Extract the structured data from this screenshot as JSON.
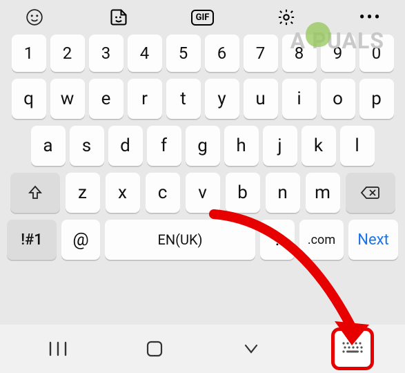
{
  "toolbar": {
    "gif_label": "GIF"
  },
  "watermark": "A  PUALS",
  "rows": {
    "numbers": [
      "1",
      "2",
      "3",
      "4",
      "5",
      "6",
      "7",
      "8",
      "9",
      "0"
    ],
    "letters1": [
      "q",
      "w",
      "e",
      "r",
      "t",
      "y",
      "u",
      "i",
      "o",
      "p"
    ],
    "letters2": [
      "a",
      "s",
      "d",
      "f",
      "g",
      "h",
      "j",
      "k",
      "l"
    ],
    "letters3": [
      "z",
      "x",
      "c",
      "v",
      "b",
      "n",
      "m"
    ]
  },
  "bottom": {
    "fn_label": "!#1",
    "at_label": "@",
    "space_label": "EN(UK)",
    "dot_label": ".",
    "com_label": ".com",
    "next_label": "Next"
  }
}
